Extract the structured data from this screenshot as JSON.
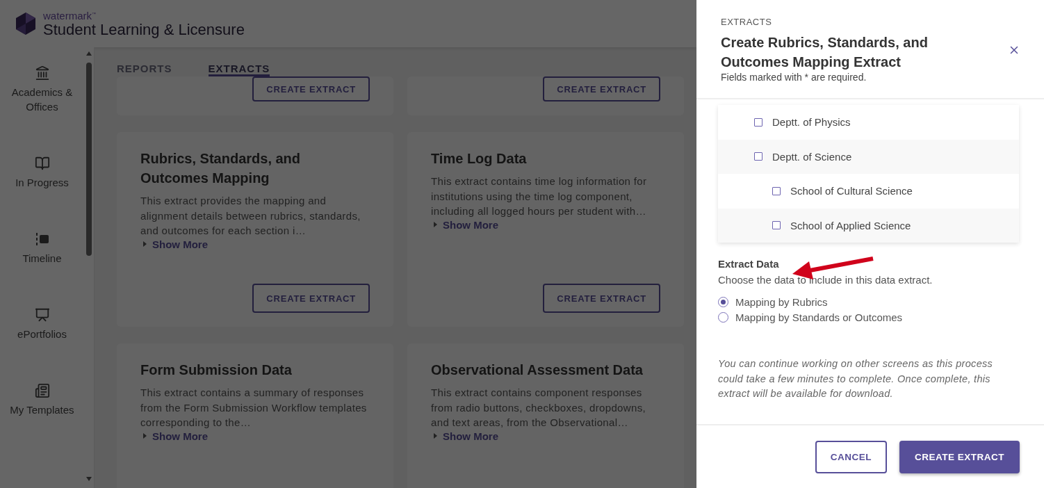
{
  "header": {
    "brand": "watermark$^{™}$",
    "title": "Student Learning & Licensure"
  },
  "sidebar": {
    "items": [
      {
        "label": "Academics & Offices"
      },
      {
        "label": "In Progress"
      },
      {
        "label": "Timeline"
      },
      {
        "label": "ePortfolios"
      },
      {
        "label": "My Templates"
      }
    ]
  },
  "tabs": [
    {
      "label": "REPORTS",
      "selected": false
    },
    {
      "label": "EXTRACTS",
      "selected": true
    }
  ],
  "cards": [
    {
      "kind": "cut",
      "button": "CREATE EXTRACT"
    },
    {
      "kind": "cut",
      "button": "CREATE EXTRACT"
    },
    {
      "kind": "full",
      "title": "Rubrics, Standards, and Outcomes Mapping",
      "description": "This extract provides the mapping and alignment details between rubrics, standards, and outcomes for each section i…",
      "more": "Show More",
      "button": "CREATE EXTRACT"
    },
    {
      "kind": "full",
      "title": "Time Log Data",
      "description": "This extract contains time log information for institutions using the time log component, including all logged hours per student with…",
      "more": "Show More",
      "button": "CREATE EXTRACT"
    },
    {
      "kind": "full",
      "title": "Form Submission Data",
      "description": "This extract contains a summary of responses from the Form Submission Workflow templates corresponding to the…",
      "more": "Show More"
    },
    {
      "kind": "full",
      "title": "Observational Assessment Data",
      "description": "This extract contains component responses from radio buttons, checkboxes, dropdowns, and text areas, from the Observational…",
      "more": "Show More"
    }
  ],
  "panel": {
    "eyebrow": "EXTRACTS",
    "title": "Create Rubrics, Standards, and Outcomes Mapping Extract",
    "required_note": "Fields marked with * are required.",
    "tree": [
      {
        "label": "Deptt. of Physics",
        "checked": false
      },
      {
        "label": "Deptt. of Science",
        "checked": false,
        "children": [
          {
            "label": "School of Cultural Science",
            "checked": false
          },
          {
            "label": "School of Applied Science",
            "checked": false
          }
        ]
      }
    ],
    "section_title": "Extract Data",
    "section_hint": "Choose the data to include in this data extract.",
    "options": [
      {
        "label": "Mapping by Rubrics",
        "selected": true
      },
      {
        "label": "Mapping by Standards or Outcomes",
        "selected": false
      }
    ],
    "note": "You can continue working on other screens as this process could take a few minutes to complete. Once complete, this extract will be available for download.",
    "buttons": [
      {
        "kind": "secondary",
        "label": "CANCEL"
      },
      {
        "kind": "primary",
        "label": "CREATE EXTRACT"
      }
    ]
  }
}
